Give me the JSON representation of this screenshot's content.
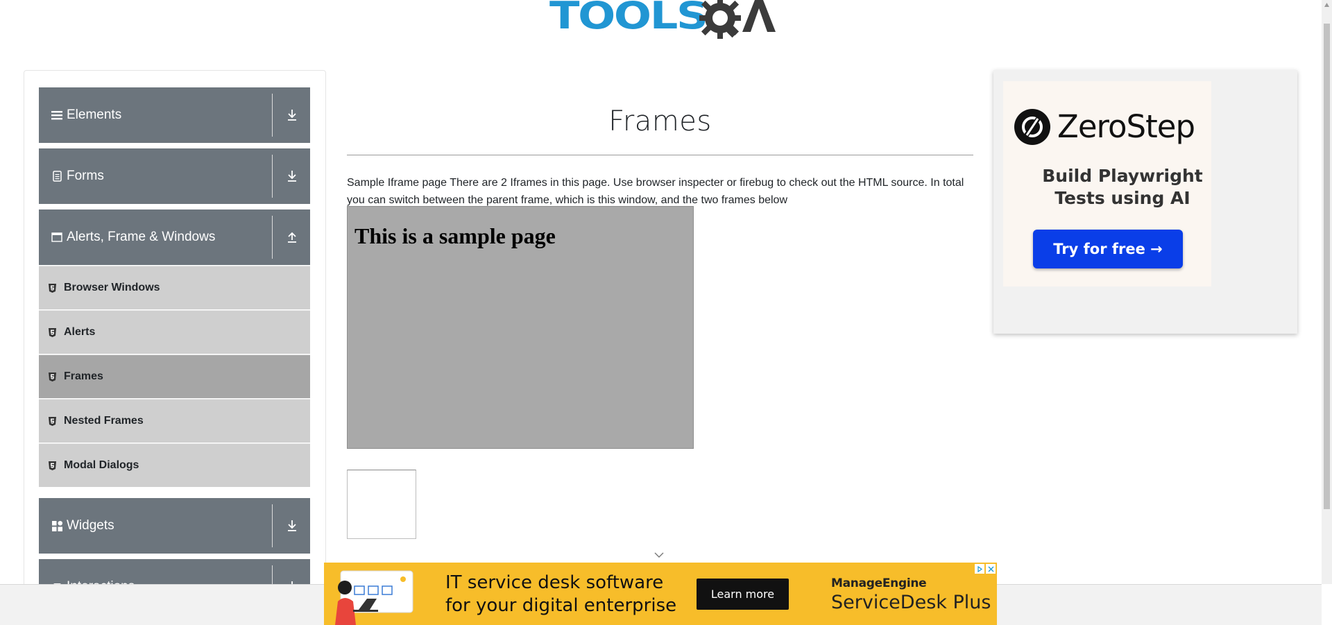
{
  "header": {
    "logo_text_tools": "TOOLS",
    "logo_text_qa": "QA"
  },
  "sidebar": {
    "groups": [
      {
        "label": "Elements",
        "icon": "hamburger-icon",
        "arrow": "download-icon"
      },
      {
        "label": "Forms",
        "icon": "document-icon",
        "arrow": "download-icon"
      },
      {
        "label": "Alerts, Frame & Windows",
        "icon": "window-icon",
        "arrow": "upload-icon"
      },
      {
        "label": "Widgets",
        "icon": "grid-icon",
        "arrow": "download-icon"
      },
      {
        "label": "Interactions",
        "icon": "hand-icon",
        "arrow": "download-icon"
      }
    ],
    "items": [
      {
        "label": "Browser Windows"
      },
      {
        "label": "Alerts"
      },
      {
        "label": "Frames",
        "active": true
      },
      {
        "label": "Nested Frames"
      },
      {
        "label": "Modal Dialogs"
      }
    ]
  },
  "main": {
    "title": "Frames",
    "description": "Sample Iframe page There are 2 Iframes in this page. Use browser inspecter or firebug to check out the HTML source. In total you can switch between the parent frame, which is this window, and the two frames below",
    "frame1_heading": "This is a sample page"
  },
  "right_ad": {
    "brand": "ZeroStep",
    "tagline_line1": "Build Playwright",
    "tagline_line2": "Tests using AI",
    "button": "Try for free →",
    "button_color": "#0a3ee8"
  },
  "bottom_ad": {
    "line1": "IT service desk software",
    "line2": "for your digital enterprise",
    "button": "Learn more",
    "brand1": "ManageEngine",
    "brand2": "ServiceDesk Plus",
    "bg_color": "#f7bd2a"
  },
  "colors": {
    "sidebar_group": "#6c757d",
    "sidebar_item": "#cfcfcf",
    "sidebar_item_active": "#a6a6a6",
    "logo_blue": "#2196d3"
  }
}
